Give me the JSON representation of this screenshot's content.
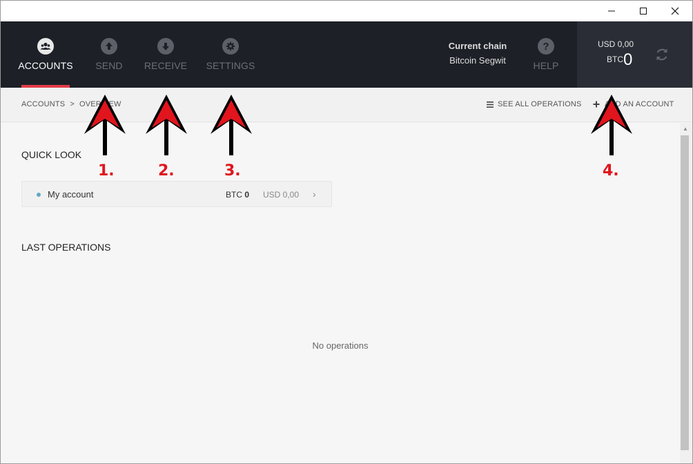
{
  "window": {
    "minimize_icon": "minimize-icon",
    "maximize_icon": "maximize-icon",
    "close_icon": "close-icon"
  },
  "nav": {
    "items": [
      {
        "label": "ACCOUNTS",
        "icon": "users-icon",
        "active": true
      },
      {
        "label": "SEND",
        "icon": "upload-icon",
        "active": false
      },
      {
        "label": "RECEIVE",
        "icon": "download-icon",
        "active": false
      },
      {
        "label": "SETTINGS",
        "icon": "gear-icon",
        "active": false
      }
    ],
    "chain_title": "Current chain",
    "chain_value": "Bitcoin Segwit",
    "help_label": "HELP",
    "help_icon": "question-icon",
    "accent_color": "#e33d48"
  },
  "balance": {
    "usd_label": "USD 0,00",
    "btc_label": "BTC",
    "btc_value": "0",
    "refresh_icon": "refresh-icon"
  },
  "subheader": {
    "breadcrumb_root": "ACCOUNTS",
    "breadcrumb_sep": ">",
    "breadcrumb_current": "OVERVIEW",
    "see_all": "SEE ALL OPERATIONS",
    "add_account": "ADD AN ACCOUNT"
  },
  "quick_look": {
    "title": "QUICK LOOK",
    "accounts": [
      {
        "name": "My account",
        "btc_unit": "BTC",
        "btc_amount": "0",
        "usd": "USD 0,00",
        "dot_color": "#5fa8c4"
      }
    ]
  },
  "last_operations": {
    "title": "LAST OPERATIONS",
    "empty_text": "No operations"
  },
  "annotations": {
    "labels": [
      "1.",
      "2.",
      "3.",
      "4."
    ],
    "color": "#e0151d"
  }
}
